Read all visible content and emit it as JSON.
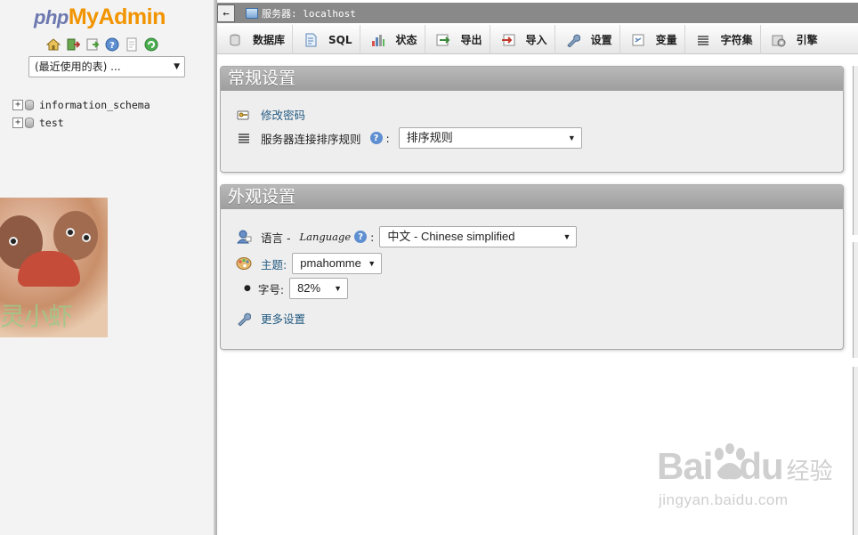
{
  "logo": {
    "php": "php",
    "my": "My",
    "admin": "Admin"
  },
  "nav": {
    "icons": [
      "home-icon",
      "exit-icon",
      "query-icon",
      "docs-icon",
      "sql-docs-icon",
      "reload-icon"
    ],
    "recent_select": "(最近使用的表) ...",
    "databases": [
      "information_schema",
      "test"
    ],
    "watermark_text": "灵小虾"
  },
  "topbar": {
    "collapse_glyph": "←",
    "server_label": "服务器: localhost"
  },
  "menu": {
    "tabs": [
      {
        "label": "数据库",
        "icon": "database-icon"
      },
      {
        "label": "SQL",
        "icon": "sql-icon"
      },
      {
        "label": "状态",
        "icon": "status-icon"
      },
      {
        "label": "导出",
        "icon": "export-icon"
      },
      {
        "label": "导入",
        "icon": "import-icon"
      },
      {
        "label": "设置",
        "icon": "settings-icon"
      },
      {
        "label": "变量",
        "icon": "variables-icon"
      },
      {
        "label": "字符集",
        "icon": "charset-icon"
      },
      {
        "label": "引擎",
        "icon": "engine-icon"
      }
    ]
  },
  "general": {
    "title": "常规设置",
    "change_password": "修改密码",
    "collation_label": "服务器连接排序规则",
    "collation_select": "排序规则"
  },
  "appearance": {
    "title": "外观设置",
    "language_label": "语言 - ",
    "language_word": "Language",
    "language_select": "中文 - Chinese simplified",
    "theme_label": "主题:",
    "theme_select": "pmahomme",
    "font_size_label": "字号:",
    "font_size_select": "82%",
    "more_settings": "更多设置"
  },
  "watermark": {
    "brand": "Bai",
    "brand2": "du",
    "cn": "经验",
    "url": "jingyan.baidu.com"
  },
  "colors": {
    "link": "#235a81",
    "header_bg": "#9e9e9e",
    "topbar_bg": "#898989",
    "logo_orange": "#f29400",
    "logo_blue": "#6c78af"
  }
}
